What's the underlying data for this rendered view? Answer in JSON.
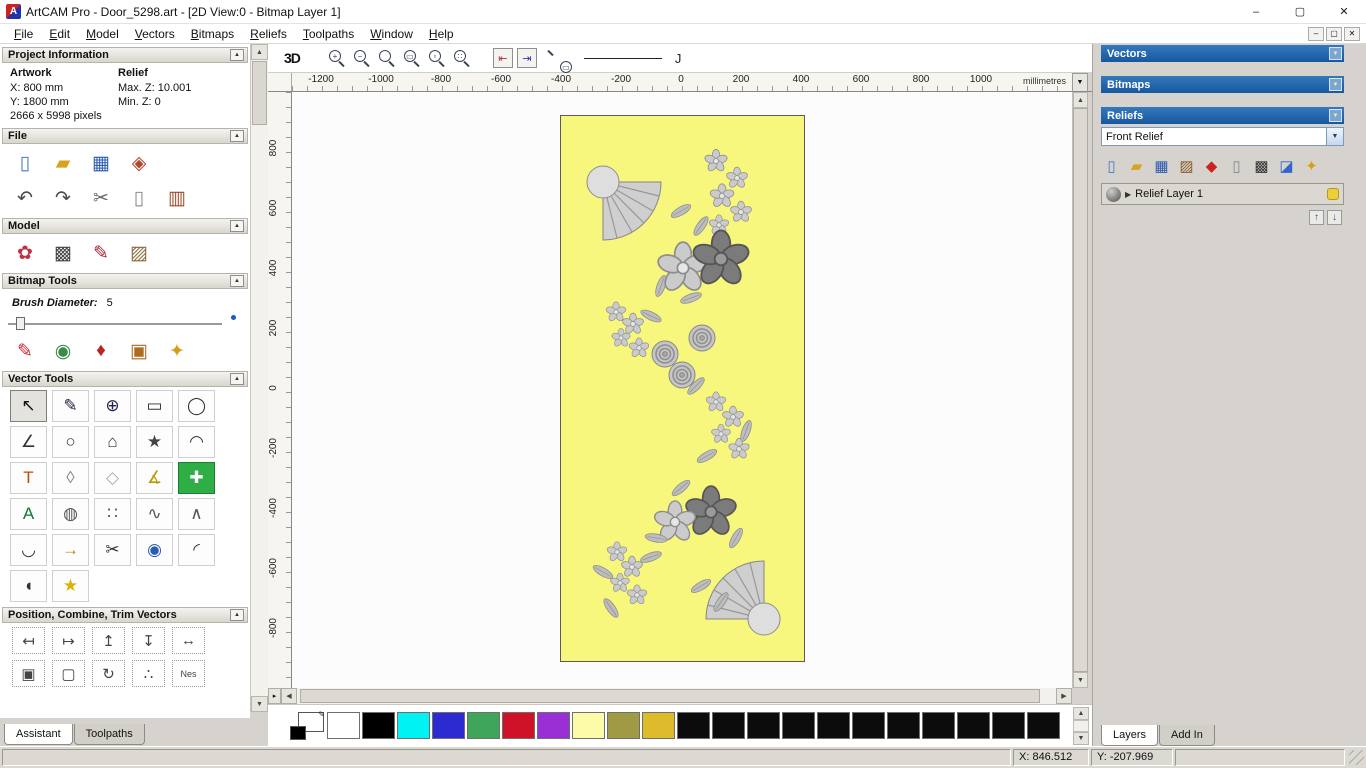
{
  "titlebar": {
    "title": "ArtCAM Pro - Door_5298.art - [2D View:0 - Bitmap Layer 1]",
    "app_initial": "A",
    "minimize": "–",
    "maximize": "▢",
    "close": "✕"
  },
  "menu": {
    "items": [
      "File",
      "Edit",
      "Model",
      "Vectors",
      "Bitmaps",
      "Reliefs",
      "Toolpaths",
      "Window",
      "Help"
    ],
    "mdi": [
      "–",
      "▢",
      "✕"
    ]
  },
  "left_panel": {
    "project_info": {
      "title": "Project Information",
      "artwork_heading": "Artwork",
      "relief_heading": "Relief",
      "artwork_lines": [
        "X: 800 mm",
        "Y: 1800 mm",
        "2666 x 5998 pixels"
      ],
      "relief_lines": [
        "Max. Z: 10.001",
        "Min. Z: 0"
      ]
    },
    "file": {
      "title": "File",
      "rows": [
        [
          "new-model",
          "open-model",
          "save-model",
          "import-export"
        ],
        [
          "undo",
          "redo",
          "cut",
          "paste",
          "record"
        ]
      ]
    },
    "model": {
      "title": "Model",
      "icons": [
        "clipart",
        "greyscale",
        "sculpt",
        "photo"
      ]
    },
    "bitmap_tools": {
      "title": "Bitmap Tools",
      "brush_label": "Brush Diameter:",
      "brush_value": "5",
      "icons": [
        "paint",
        "palette",
        "pick-colour",
        "paint-set",
        "flood-fill"
      ]
    },
    "vector_tools": {
      "title": "Vector Tools",
      "rows": [
        [
          "select",
          "node-edit",
          "transform",
          "rectangle",
          "circle"
        ],
        [
          "polyline",
          "ellipse",
          "polygon",
          "star",
          "arc"
        ],
        [
          "text",
          "distort",
          "diamond",
          "measure",
          "block-paste"
        ],
        [
          "text-block",
          "wrap-sphere",
          "nesting",
          "fit-arcs",
          "fit-lines"
        ],
        [
          "fillet",
          "offset",
          "trim",
          "extrude",
          "join"
        ],
        [
          "mirror-merge",
          "star-wizard"
        ]
      ]
    },
    "position_tools": {
      "title": "Position, Combine, Trim Vectors",
      "rows": [
        [
          "align-left",
          "align-right",
          "align-top",
          "align-bottom",
          "align-centre"
        ],
        [
          "centre-page",
          "block-copy",
          "rotate-copy",
          "nudge",
          "nest"
        ]
      ],
      "nest_label": "Nes"
    },
    "tabs": [
      {
        "label": "Assistant",
        "active": true
      },
      {
        "label": "Toolpaths",
        "active": false
      }
    ]
  },
  "canvas": {
    "toolbar": {
      "btn_3d": "3D",
      "zoom_icons": [
        "zoom-in",
        "zoom-out",
        "zoom-last",
        "zoom-fit",
        "zoom-page",
        "zoom-area"
      ],
      "toggles": [
        "snap-prev",
        "snap-next"
      ],
      "extra_zoom": "zoom-selection",
      "curve_preview": "J"
    },
    "ruler_units": "millimetres",
    "ruler_h": [
      -1200,
      -1000,
      -800,
      -600,
      -400,
      -200,
      0,
      200,
      400,
      600,
      800,
      1000
    ],
    "ruler_v": [
      800,
      600,
      400,
      200,
      0,
      -200,
      -400,
      -600,
      -800
    ]
  },
  "right_panel": {
    "panels": [
      {
        "title": "Vectors"
      },
      {
        "title": "Bitmaps"
      }
    ],
    "reliefs": {
      "title": "Reliefs",
      "selected": "Front Relief",
      "toolbar": [
        "new-relief",
        "open-relief",
        "save-relief",
        "texture",
        "colour-gem",
        "new-layer",
        "greyscale-view",
        "delete-layer",
        "wizard"
      ],
      "layer_name": "Relief Layer 1"
    },
    "tabs": [
      {
        "label": "Layers",
        "active": true
      },
      {
        "label": "Add In",
        "active": false
      }
    ]
  },
  "palette": {
    "swatches": [
      "#ffffff",
      "#000000",
      "#00f2f2",
      "#2b2bd0",
      "#3ea55b",
      "#d01228",
      "#9a2fd6",
      "#fbfba8",
      "#a09a45",
      "#debb2a",
      "#0c0c0c",
      "#0c0c0c",
      "#0c0c0c",
      "#0c0c0c",
      "#0c0c0c",
      "#0c0c0c",
      "#0c0c0c",
      "#0c0c0c",
      "#0c0c0c",
      "#0c0c0c",
      "#0c0c0c"
    ]
  },
  "status": {
    "x": "X: 846.512",
    "y": "Y: -207.969"
  },
  "colors": {
    "accent_blue": "#17579e",
    "artwork_bg": "#f7f77e"
  }
}
